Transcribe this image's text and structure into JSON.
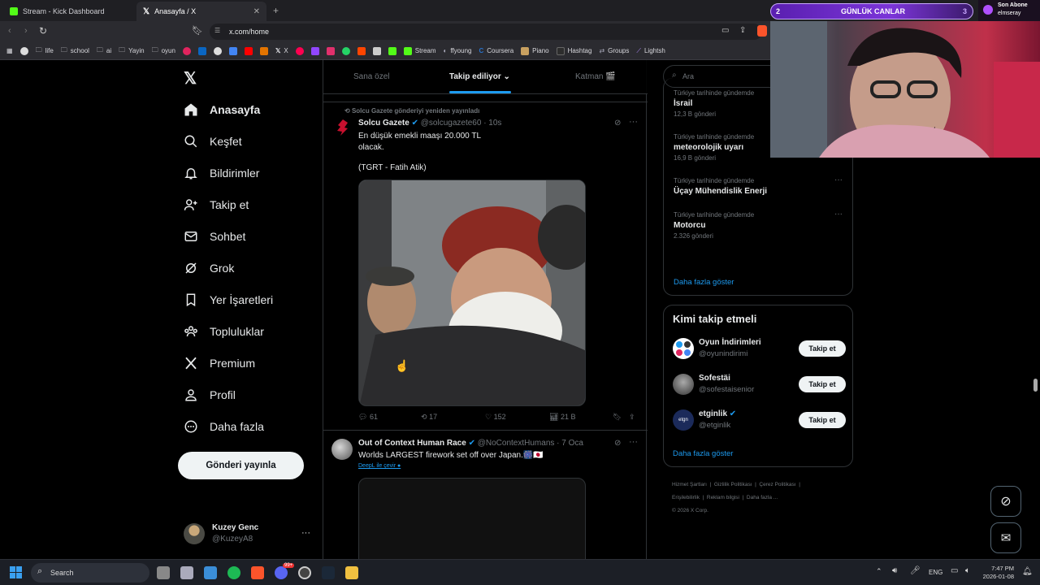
{
  "browser": {
    "tabs": [
      {
        "label": "Stream - Kick Dashboard"
      },
      {
        "label": "Anasayfa / X"
      }
    ],
    "url": "x.com/home",
    "bookmarks": [
      "life",
      "school",
      "ai",
      "Yayin",
      "oyun",
      "X",
      "Stream",
      "ffyoung",
      "Coursera",
      "Piano",
      "Hashtag",
      "Groups",
      "Lightsh"
    ]
  },
  "overlay": {
    "count_left": "2",
    "title": "GÜNLÜK CANLAR",
    "count_right": "3",
    "sub_label": "Son Abone",
    "sub_name": "elmseray"
  },
  "nav": {
    "items": [
      {
        "label": "Anasayfa",
        "icon": "home-icon"
      },
      {
        "label": "Keşfet",
        "icon": "search-icon"
      },
      {
        "label": "Bildirimler",
        "icon": "bell-icon"
      },
      {
        "label": "Takip et",
        "icon": "follow-icon"
      },
      {
        "label": "Sohbet",
        "icon": "mail-icon"
      },
      {
        "label": "Grok",
        "icon": "grok-icon"
      },
      {
        "label": "Yer İşaretleri",
        "icon": "bookmark-icon"
      },
      {
        "label": "Topluluklar",
        "icon": "communities-icon"
      },
      {
        "label": "Premium",
        "icon": "x-logo-icon"
      },
      {
        "label": "Profil",
        "icon": "profile-icon"
      },
      {
        "label": "Daha fazla",
        "icon": "more-circle-icon"
      }
    ],
    "post_button": "Gönderi yayınla",
    "account": {
      "name": "Kuzey Genc",
      "handle": "@KuzeyA8"
    }
  },
  "feed": {
    "tabs": [
      "Sana özel",
      "Takip ediliyor",
      "Katman 🎬"
    ],
    "tweet1": {
      "repost_note": "Solcu Gazete gönderiyi yeniden yayınladı",
      "name": "Solcu Gazete",
      "handle": "@solcugazete60",
      "time": "· 10s",
      "text_line1": "En düşük emekli maaşı 20.000 TL",
      "text_line2": "olacak.",
      "text_line3": "(TGRT - Fatih Atik)",
      "replies": "61",
      "reposts": "17",
      "likes": "152",
      "views": "21 B"
    },
    "tweet2": {
      "name": "Out of Context Human Race",
      "handle": "@NoContextHumans",
      "time": "· 7 Oca",
      "text": "Worlds LARGEST firework set off over Japan.🎆🇯🇵",
      "translate": "DeepL ile çevir"
    }
  },
  "right": {
    "search_placeholder": "Ara",
    "trends": [
      {
        "context": "Türkiye tarihinde gündemde",
        "name": "İsrail",
        "count": "12,3 B gönderi"
      },
      {
        "context": "Türkiye tarihinde gündemde",
        "name": "meteorolojik uyarı",
        "count": "16,9 B gönderi"
      },
      {
        "context": "Türkiye tarihinde gündemde",
        "name": "Üçay Mühendislik Enerji",
        "count": ""
      },
      {
        "context": "Türkiye tarihinde gündemde",
        "name": "Motorcu",
        "count": "2.326 gönderi"
      }
    ],
    "show_more": "Daha fazla göster",
    "who_to_follow_title": "Kimi takip etmeli",
    "suggestions": [
      {
        "name": "Oyun İndirimleri",
        "handle": "@oyunindirimi",
        "button": "Takip et"
      },
      {
        "name": "Sofestäi",
        "handle": "@sofestaisenior",
        "button": "Takip et"
      },
      {
        "name": "etginlik",
        "handle": "@etginlik",
        "button": "Takip et"
      }
    ],
    "show_more2": "Daha fazla göster",
    "footer": [
      "Hizmet Şartları",
      "Gizlilik Politikası",
      "Çerez Politikası",
      "Erişilebilirlik",
      "Reklam bilgisi",
      "Daha fazla ...",
      "© 2026 X Corp."
    ]
  },
  "taskbar": {
    "search": "Search",
    "lang": "ENG",
    "time": "7:47 PM",
    "date": "2026-01-08",
    "notify_badge": "99+"
  }
}
